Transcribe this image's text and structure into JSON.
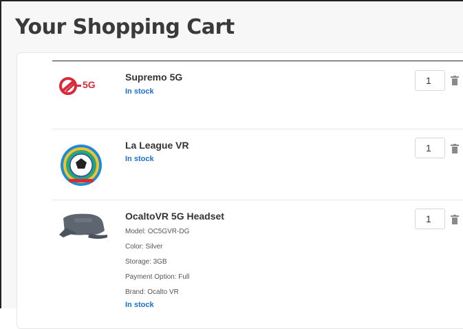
{
  "page": {
    "title": "Your Shopping Cart"
  },
  "items": [
    {
      "logo_text": "5G",
      "name": "Supremo 5G",
      "stock": "In stock",
      "quantity": "1",
      "attributes": []
    },
    {
      "name": "La League VR",
      "stock": "In stock",
      "quantity": "1",
      "attributes": []
    },
    {
      "name": "OcaltoVR 5G Headset",
      "stock": "In stock",
      "quantity": "1",
      "attributes": [
        "Model: OC5GVR-DG",
        "Color: Silver",
        "Storage: 3GB",
        "Payment Option: Full",
        "Brand: Ocalto VR"
      ]
    }
  ],
  "colors": {
    "accent_blue": "#1a6fd1",
    "brand_red": "#d92a3a",
    "title_gray": "#3a3a3a"
  }
}
